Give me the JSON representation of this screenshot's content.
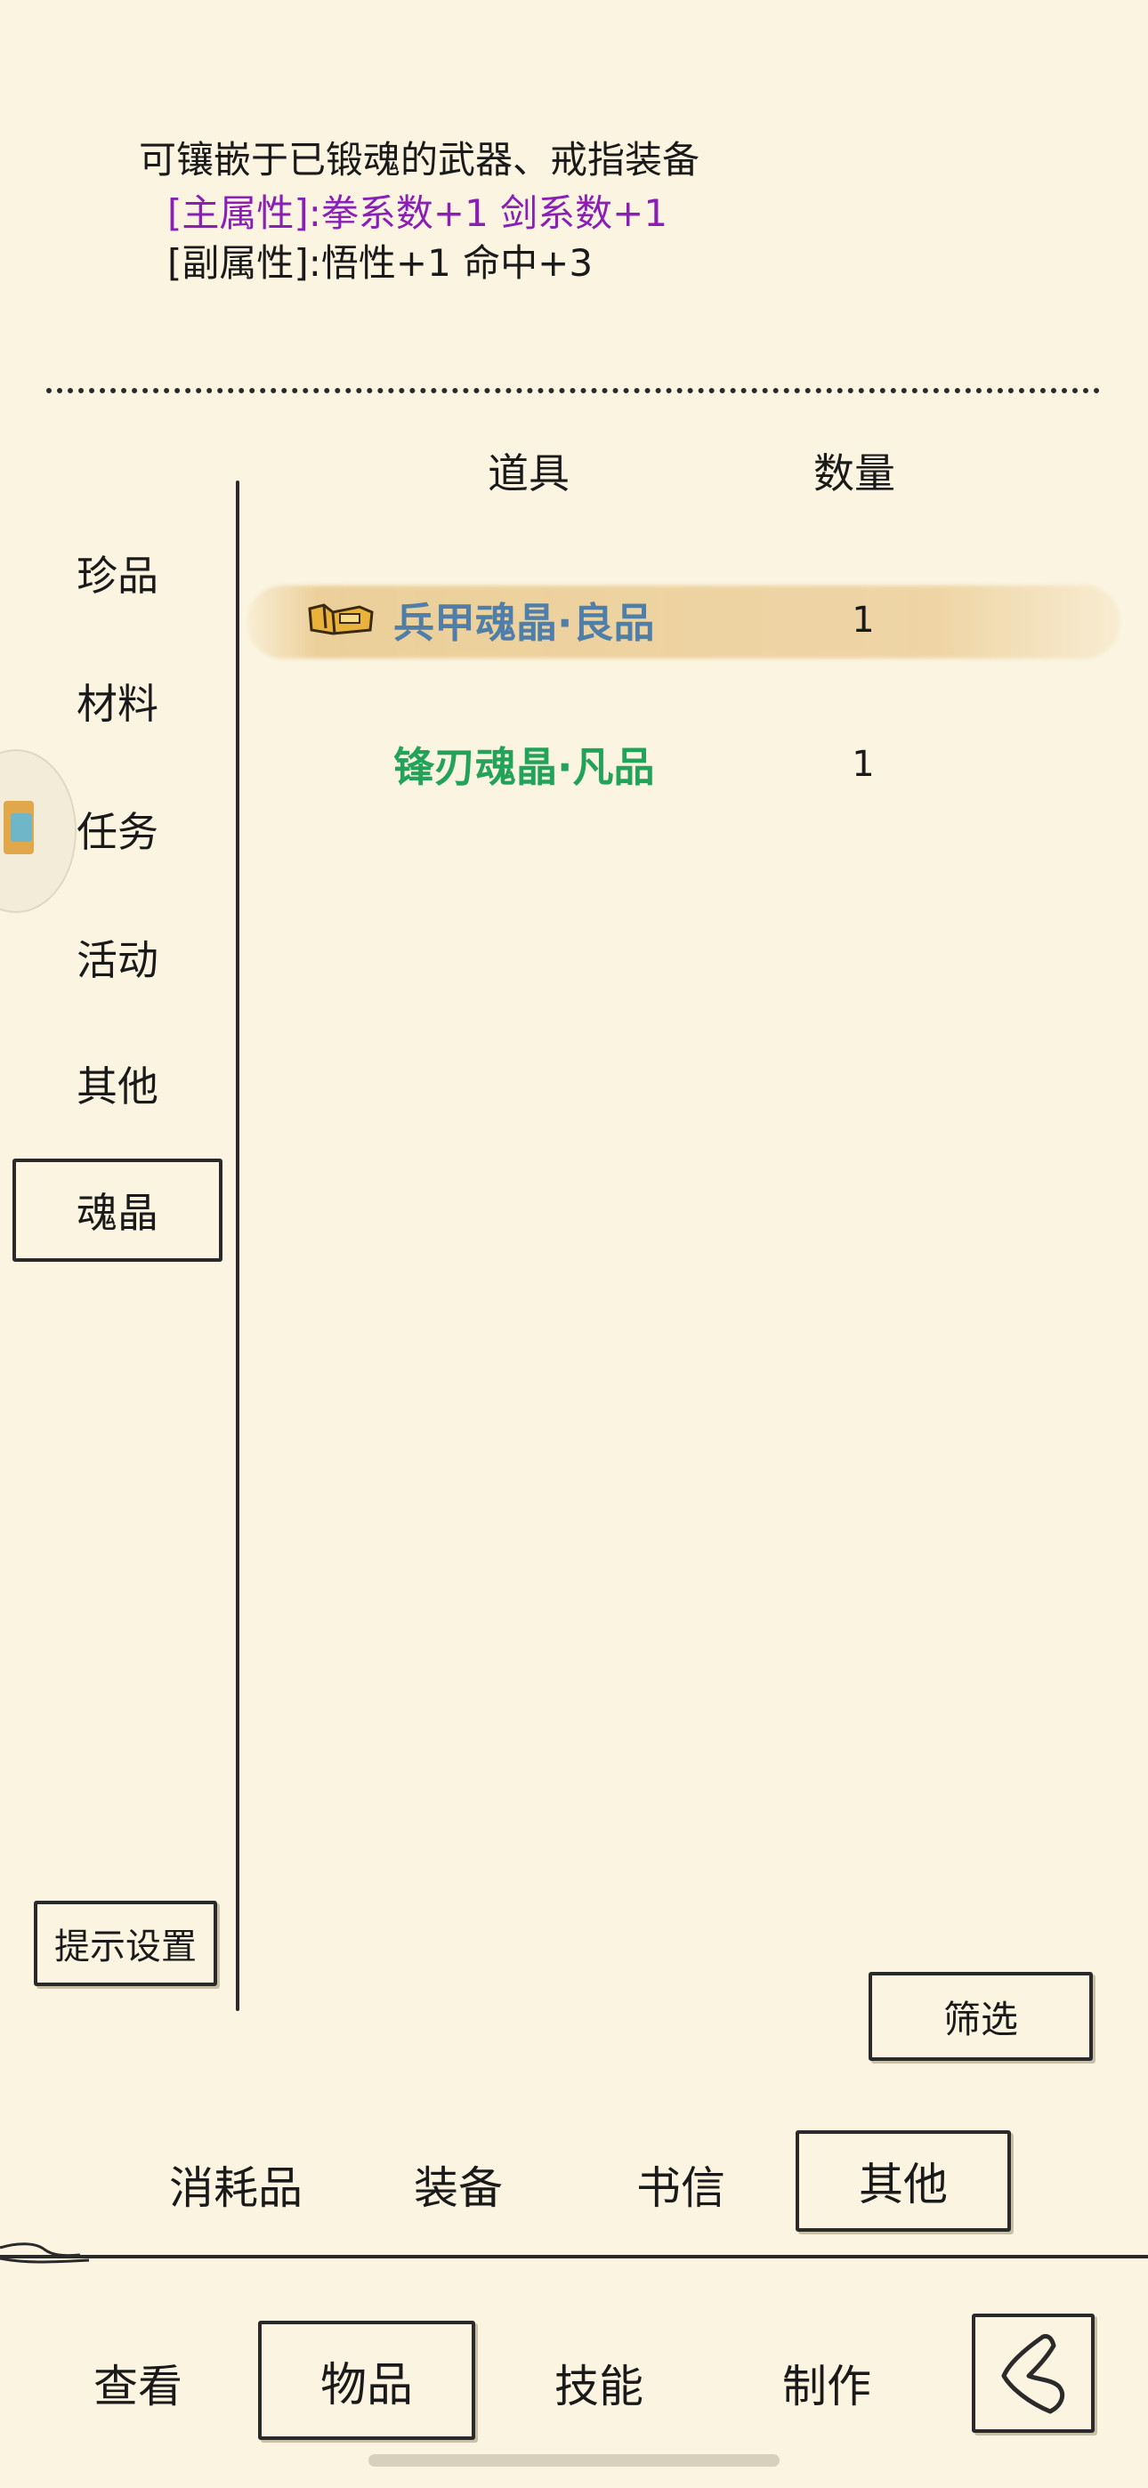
{
  "description": {
    "line1": "可镶嵌于已锻魂的武器、戒指装备",
    "main_attr": "[主属性]:拳系数+1 剑系数+1",
    "sub_attr": "[副属性]:悟性+1 命中+3"
  },
  "sidebar": {
    "items": [
      {
        "label": "珍品"
      },
      {
        "label": "材料"
      },
      {
        "label": "任务"
      },
      {
        "label": "活动"
      },
      {
        "label": "其他"
      },
      {
        "label": "魂晶"
      }
    ],
    "active_index": 5,
    "settings_label": "提示设置"
  },
  "table": {
    "headers": {
      "item": "道具",
      "qty": "数量"
    },
    "rows": [
      {
        "name": "兵甲魂晶·良品",
        "qty": "1",
        "color": "#4f7fa8",
        "selected": true,
        "icon": "crystal-box-icon"
      },
      {
        "name": "锋刃魂晶·凡品",
        "qty": "1",
        "color": "#23a35a",
        "selected": false
      }
    ]
  },
  "filter_label": "筛选",
  "category_tabs": {
    "items": [
      {
        "label": "消耗品"
      },
      {
        "label": "装备"
      },
      {
        "label": "书信"
      },
      {
        "label": "其他"
      }
    ],
    "active_index": 3
  },
  "bottom_nav": {
    "items": [
      {
        "label": "查看"
      },
      {
        "label": "物品"
      },
      {
        "label": "技能"
      },
      {
        "label": "制作"
      }
    ],
    "active_index": 1,
    "back_icon": "back-arrow-icon"
  },
  "colors": {
    "background": "#fbf4e0",
    "main_attr": "#8a1fb5",
    "ink": "#1a1a1a"
  }
}
